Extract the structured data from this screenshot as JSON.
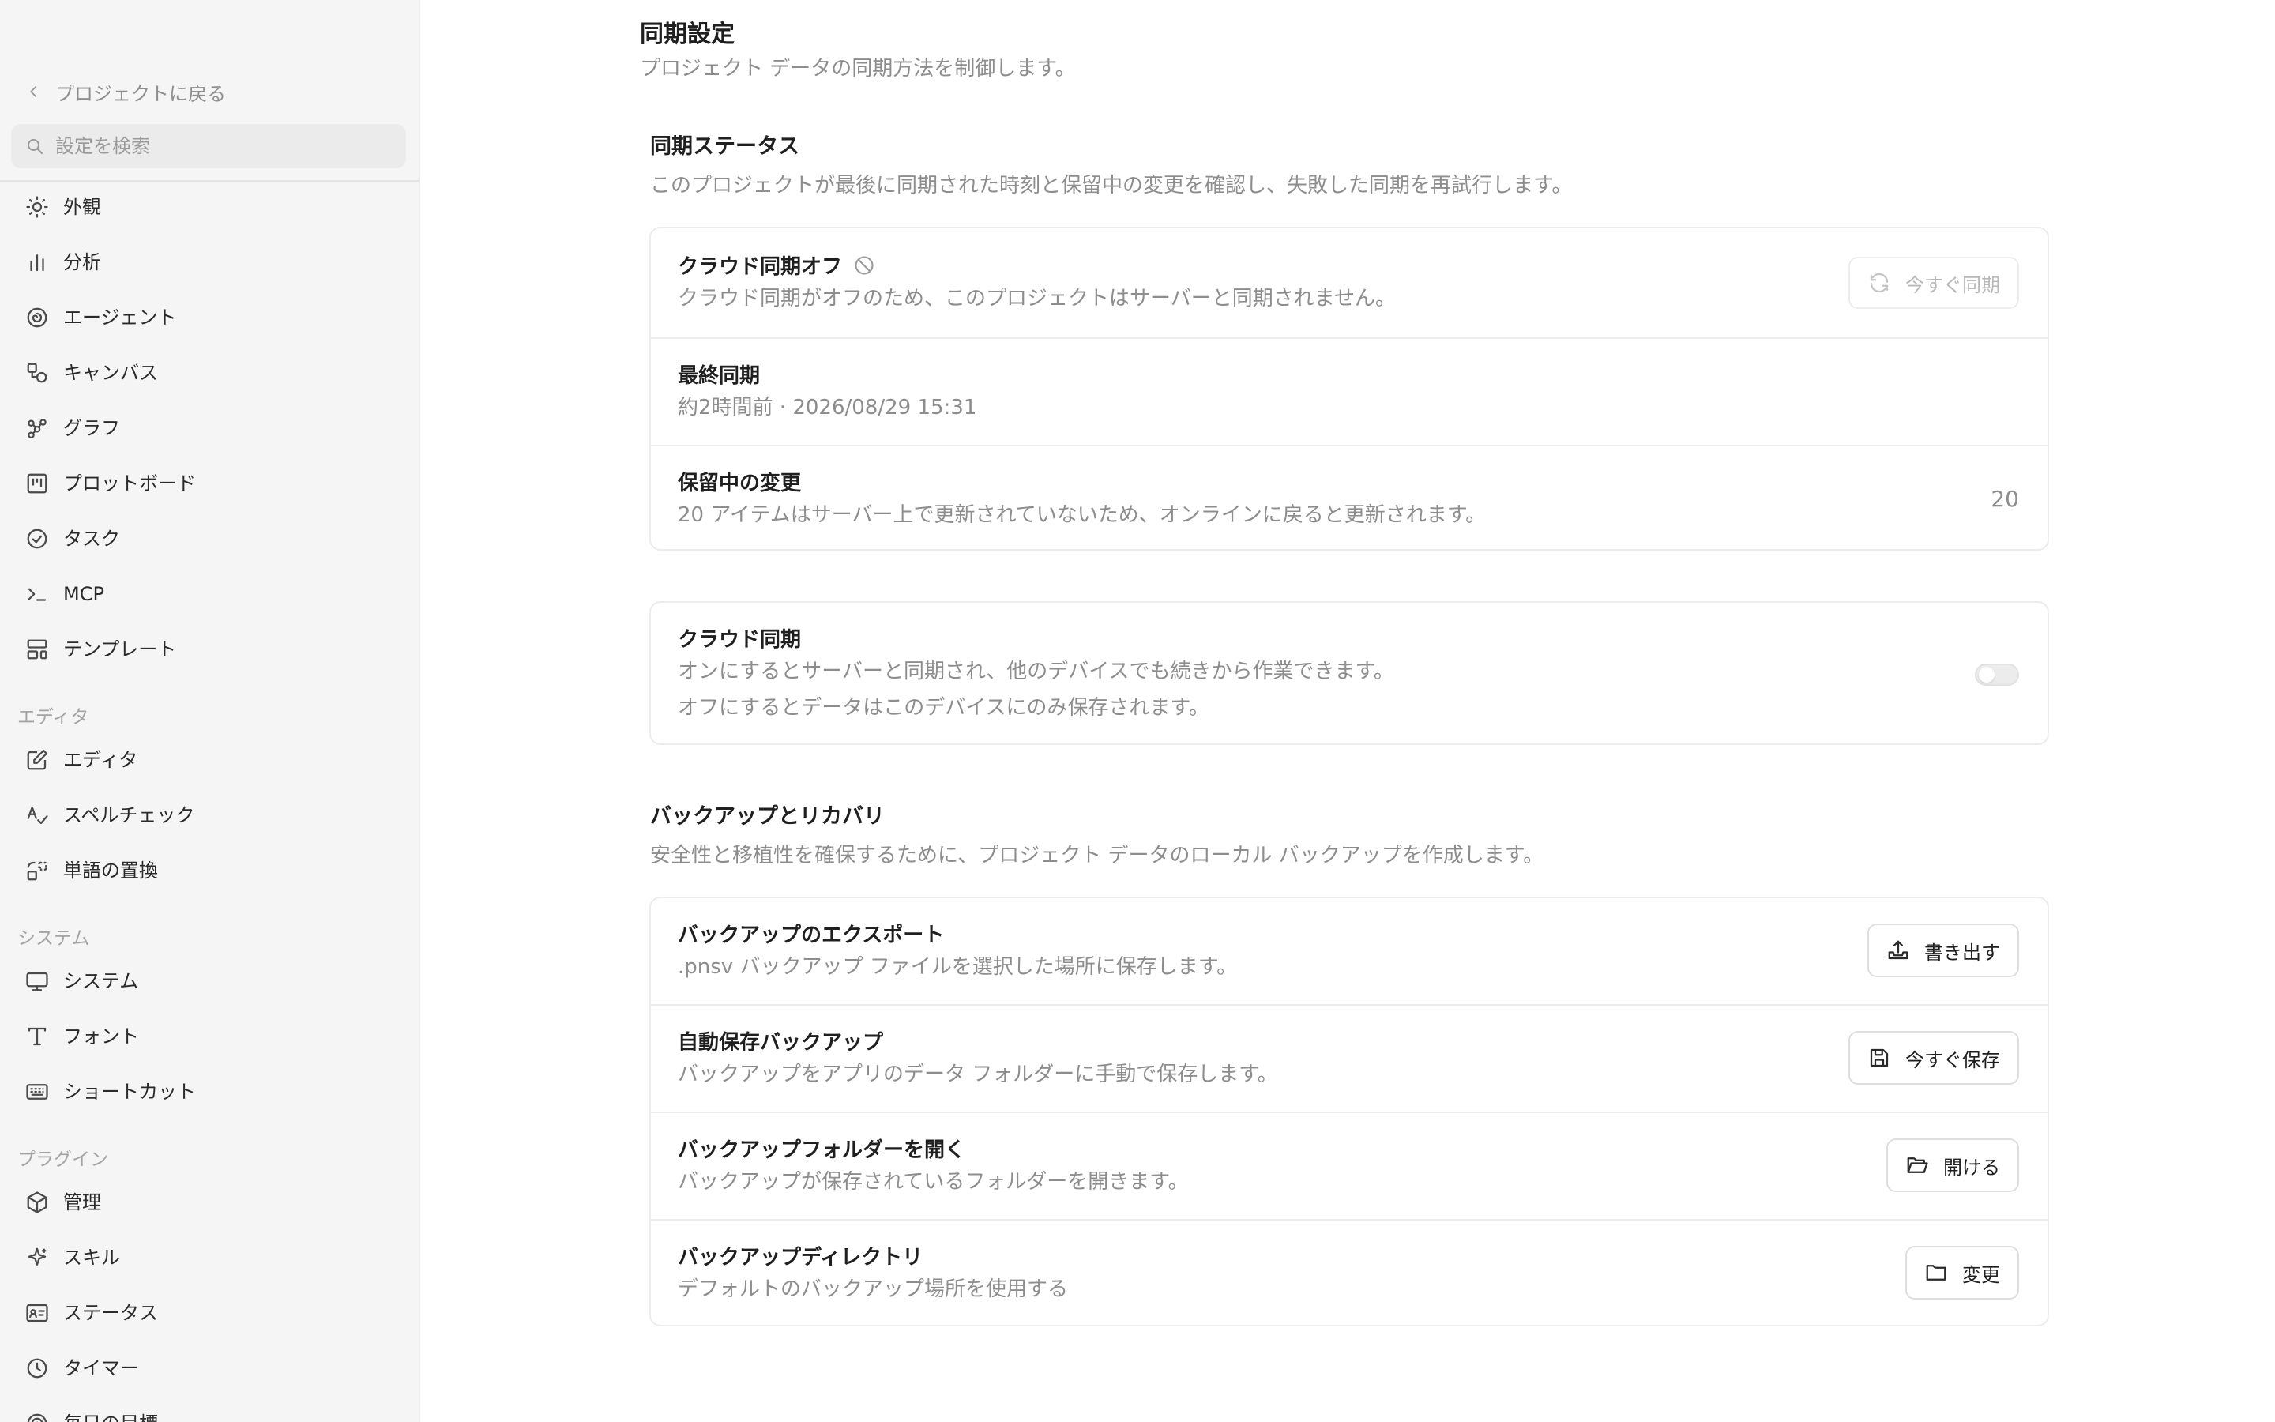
{
  "sidebar": {
    "back_label": "プロジェクトに戻る",
    "search_placeholder": "設定を検索",
    "items": [
      {
        "label": "外観",
        "icon": "sun-icon"
      },
      {
        "label": "分析",
        "icon": "bar-chart-icon"
      },
      {
        "label": "エージェント",
        "icon": "spiral-icon"
      },
      {
        "label": "キャンバス",
        "icon": "shapes-icon"
      },
      {
        "label": "グラフ",
        "icon": "graph-nodes-icon"
      },
      {
        "label": "プロットボード",
        "icon": "kanban-icon"
      },
      {
        "label": "タスク",
        "icon": "check-circle-icon"
      },
      {
        "label": "MCP",
        "icon": "terminal-icon"
      },
      {
        "label": "テンプレート",
        "icon": "layout-template-icon"
      }
    ],
    "section_editor": "エディタ",
    "editor_items": [
      {
        "label": "エディタ",
        "icon": "edit-icon"
      },
      {
        "label": "スペルチェック",
        "icon": "spell-check-icon"
      },
      {
        "label": "単語の置換",
        "icon": "replace-icon"
      }
    ],
    "section_system": "システム",
    "system_items": [
      {
        "label": "システム",
        "icon": "monitor-icon"
      },
      {
        "label": "フォント",
        "icon": "type-icon"
      },
      {
        "label": "ショートカット",
        "icon": "keyboard-icon"
      }
    ],
    "section_plugins": "プラグイン",
    "plugin_items": [
      {
        "label": "管理",
        "icon": "package-icon"
      },
      {
        "label": "スキル",
        "icon": "sparkle-icon"
      },
      {
        "label": "ステータス",
        "icon": "id-card-icon"
      },
      {
        "label": "タイマー",
        "icon": "clock-icon"
      },
      {
        "label": "毎日の目標",
        "icon": "target-icon"
      }
    ]
  },
  "main": {
    "title": "同期設定",
    "subtitle": "プロジェクト データの同期方法を制御します。",
    "sync_status": {
      "title": "同期ステータス",
      "desc": "このプロジェクトが最後に同期された時刻と保留中の変更を確認し、失敗した同期を再試行します。",
      "cloud_off_title": "クラウド同期オフ",
      "cloud_off_desc": "クラウド同期がオフのため、このプロジェクトはサーバーと同期されません。",
      "sync_now_label": "今すぐ同期",
      "last_sync_title": "最終同期",
      "last_sync_value": "約2時間前 · 2026/08/29 15:31",
      "pending_title": "保留中の変更",
      "pending_desc": "20 アイテムはサーバー上で更新されていないため、オンラインに戻ると更新されます。",
      "pending_count": "20"
    },
    "cloud_sync": {
      "title": "クラウド同期",
      "desc_line1": "オンにするとサーバーと同期され、他のデバイスでも続きから作業できます。",
      "desc_line2": "オフにするとデータはこのデバイスにのみ保存されます。",
      "enabled": false
    },
    "backup": {
      "title": "バックアップとリカバリ",
      "desc": "安全性と移植性を確保するために、プロジェクト データのローカル バックアップを作成します。",
      "export_title": "バックアップのエクスポート",
      "export_desc": ".pnsv バックアップ ファイルを選択した場所に保存します。",
      "export_button": "書き出す",
      "autosave_title": "自動保存バックアップ",
      "autosave_desc": "バックアップをアプリのデータ フォルダーに手動で保存します。",
      "autosave_button": "今すぐ保存",
      "open_folder_title": "バックアップフォルダーを開く",
      "open_folder_desc": "バックアップが保存されているフォルダーを開きます。",
      "open_folder_button": "開ける",
      "directory_title": "バックアップディレクトリ",
      "directory_desc": "デフォルトのバックアップ場所を使用する",
      "directory_button": "変更"
    }
  }
}
